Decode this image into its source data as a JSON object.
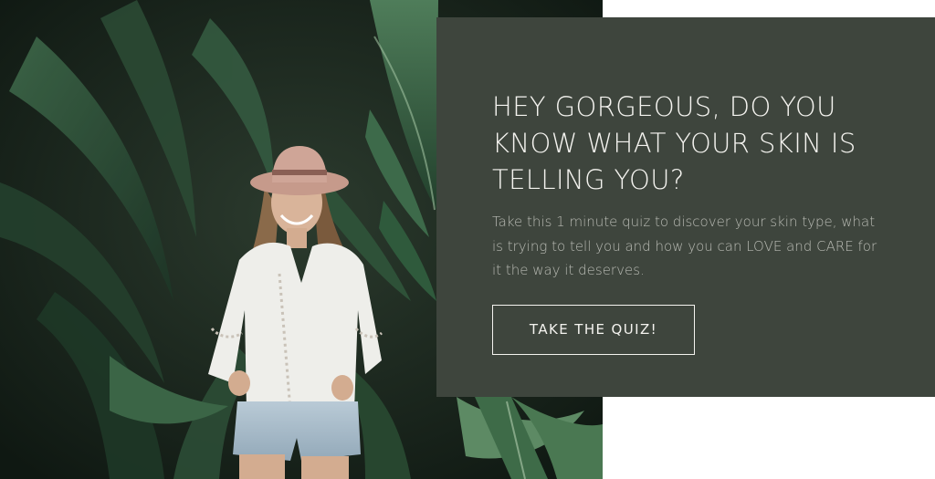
{
  "hero": {
    "image_description_icon": "woman-in-hat-among-palms-photo"
  },
  "promo": {
    "heading": "HEY GORGEOUS, DO YOU KNOW WHAT YOUR SKIN IS TELLING YOU?",
    "body": "Take this 1 minute quiz to discover your skin type, what is trying to tell you and how you can LOVE and CARE for it the way it deserves.",
    "button_label": "TAKE THE QUIZ!"
  },
  "colors": {
    "card_background": "#3e453d",
    "heading_text": "#f4f3ef",
    "body_text": "#b9bbb4",
    "page_background": "#ffffff"
  }
}
